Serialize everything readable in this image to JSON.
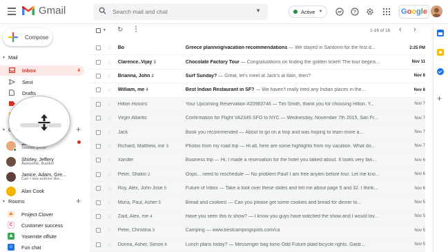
{
  "app": {
    "name": "Gmail"
  },
  "search": {
    "placeholder": "Search mail and chat"
  },
  "status": {
    "label": "Active"
  },
  "google_label": "Google",
  "compose_label": "Compose",
  "mail_section": "Mail",
  "nav": [
    {
      "label": "Inbox",
      "icon": "inbox-icon",
      "count": "4",
      "active": true
    },
    {
      "label": "Sent",
      "icon": "send-icon",
      "count": ""
    },
    {
      "label": "Drafts",
      "icon": "draft-icon",
      "count": ""
    },
    {
      "label": "Fo",
      "icon": "label-icon",
      "count": ""
    },
    {
      "label": "",
      "icon": "label-icon",
      "count": ""
    }
  ],
  "chat_section": "Chat",
  "chats": [
    {
      "name": "Ja",
      "sub": "Sounds great!"
    },
    {
      "name": "Shirley, Jeffery",
      "sub": "Awesome, thanks!"
    },
    {
      "name": "Janice, Adam, Gre...",
      "sub": "Can I see actions like..."
    },
    {
      "name": "Alan Cook",
      "sub": ""
    }
  ],
  "rooms_section": "Rooms",
  "rooms": [
    {
      "label": "Project Clover",
      "letter": "☘",
      "color": "#e37400"
    },
    {
      "label": "Customer success",
      "letter": "C",
      "color": "#e91e63"
    },
    {
      "label": "Yosemite offsite",
      "letter": "⛰",
      "color": "#1e8e3e"
    },
    {
      "label": "Fun chat",
      "letter": "☺",
      "color": "#1a73e8"
    }
  ],
  "pagination": "1-16 of 16",
  "emails": [
    {
      "sender": "Bo",
      "n": "",
      "subject": "Greece planning/vacation recommendations",
      "snippet": " — We stayed in Santorini for the first d...",
      "date": "2:25 PM",
      "unread": true
    },
    {
      "sender": "Clarence..Vijay",
      "n": "3",
      "subject": "Chocolate Factory Tour",
      "snippet": " — Congratulations on finding the golden ticket! The tour begins...",
      "date": "Nov 11",
      "unread": true
    },
    {
      "sender": "Brianna, John",
      "n": "2",
      "subject": "Surf Sunday?",
      "snippet": " — Great, let's meet at Jack's at 8am, then?",
      "date": "Nov 8",
      "unread": true
    },
    {
      "sender": "William, me",
      "n": "4",
      "subject": "Best Indian Restaurant in SF?",
      "snippet": " — We haven't really tried any Indian places in the...",
      "date": "Nov 8",
      "unread": true
    },
    {
      "sender": "Hilton Honors",
      "n": "",
      "subject": "Your Upcoming Reservation #20983746",
      "snippet": " — Tim Smith, thank you for choosing Hilton. Y...",
      "date": "Nov 7",
      "unread": false
    },
    {
      "sender": "Virgin Atlantic",
      "n": "",
      "subject": "Confirmation for Flight VA2345 SFO to NYC",
      "snippet": " — Wednesday, November 7th 2015, San Fr...",
      "date": "Nov 7",
      "unread": false
    },
    {
      "sender": "Jack",
      "n": "",
      "subject": "Book you recommended",
      "snippet": " — About to go on a trop and was hoping to learn more a...",
      "date": "Nov 7",
      "unread": false
    },
    {
      "sender": "Richard, Matthew, me",
      "n": "3",
      "subject": "Photos from my road trip",
      "snippet": " — Hi all, here are some highlights from my vacation. What do...",
      "date": "Nov 7",
      "unread": false
    },
    {
      "sender": "Xander",
      "n": "",
      "subject": "Business trip",
      "snippet": " — Hi, I made a reservation for the hotel you talked about. It looks very fan...",
      "date": "Nov 6",
      "unread": false
    },
    {
      "sender": "Peter, Shalini",
      "n": "2",
      "subject": "Oops... need to reschedule",
      "snippet": " — No problem Paul! I am free anyitm before four. Let me kno...",
      "date": "Nov 6",
      "unread": false
    },
    {
      "sender": "Roy, Alex, John Jose",
      "n": "5",
      "subject": "Future of Inbox",
      "snippet": " — Take a look over these slides and tell me about page 5 and 32. I think...",
      "date": "Nov 6",
      "unread": false
    },
    {
      "sender": "Mizra, Paul, Asher",
      "n": "5",
      "subject": "Bread and cookies!",
      "snippet": " — Can you please get some cookies and bread for dinner to...",
      "date": "Nov 5",
      "unread": false
    },
    {
      "sender": "Zaid, Alex, me",
      "n": "4",
      "subject": "Have you seen this tv show?",
      "snippet": " — I know you guys have watched the show and I would lov...",
      "date": "Nov 5",
      "unread": false
    },
    {
      "sender": "Peter, Christina",
      "n": "3",
      "subject": "Camping",
      "snippet": " — www.bestcampingspots.com/ca",
      "date": "Nov 5",
      "unread": false
    },
    {
      "sender": "Donna, Asher, Simon",
      "n": "6",
      "subject": "Lunch plans today?",
      "snippet": " — Messenger bag lomo Odd Future plaid bicycle rights. Gastr...",
      "date": "Nov 5",
      "unread": false
    }
  ],
  "colors": {
    "accent": "#d93025",
    "active_green": "#1e8e3e",
    "inbox_bg": "#fce8e6"
  }
}
